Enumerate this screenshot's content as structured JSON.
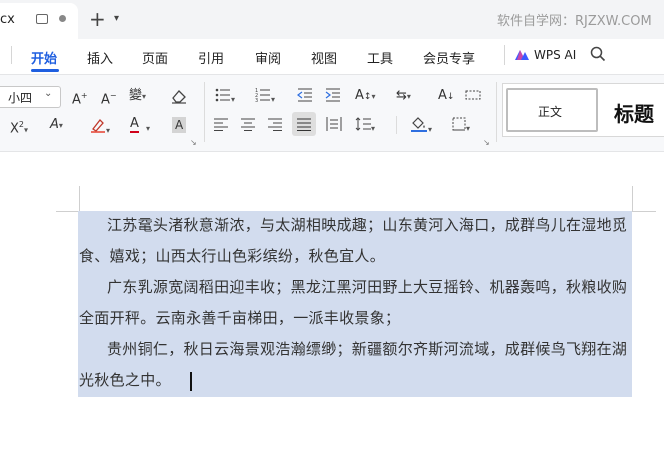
{
  "tab": {
    "name": "cx"
  },
  "watermark": "软件自学网：RJZXW.COM",
  "menu": {
    "items": [
      "开始",
      "插入",
      "页面",
      "引用",
      "审阅",
      "视图",
      "工具",
      "会员专享"
    ],
    "active_index": 0,
    "ai_label": "WPS AI"
  },
  "ribbon": {
    "font_size": "小四",
    "highlight_letter": "A",
    "styles": {
      "normal": "正文",
      "heading": "标题"
    }
  },
  "document": {
    "paragraphs": [
      "江苏鼋头渚秋意渐浓，与太湖相映成趣；山东黄河入海口，成群鸟儿在湿地觅食、嬉戏；山西太行山色彩缤纷，秋色宜人。",
      "广东乳源宽阔稻田迎丰收；黑龙江黑河田野上大豆摇铃、机器轰鸣，秋粮收购全面开秤。云南永善千亩梯田，一派丰收景象；",
      "贵州铜仁，秋日云海景观浩瀚缥缈；新疆额尔齐斯河流域，成群候鸟飞翔在湖光秋色之中。"
    ],
    "selection_color": "#d2dcee"
  },
  "colors": {
    "accent": "#1f5fe0",
    "selection": "#d2dcee"
  }
}
